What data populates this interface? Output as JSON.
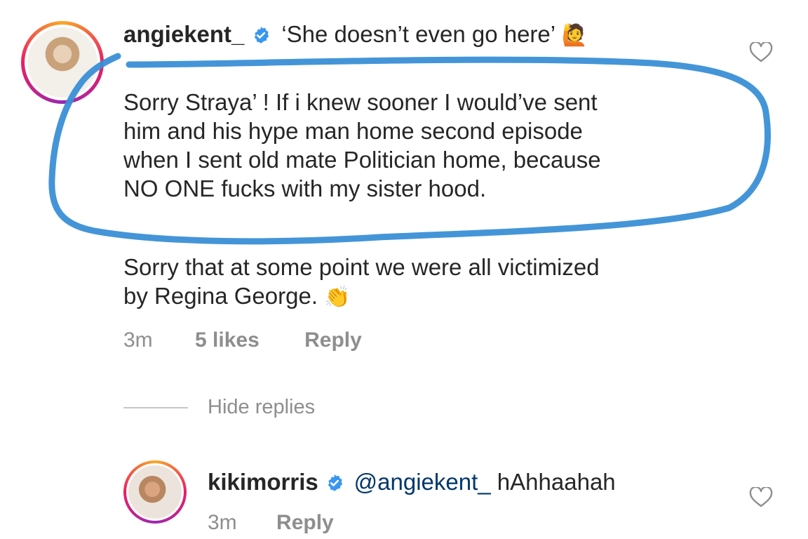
{
  "comment": {
    "username": "angiekent_",
    "headline": "‘She doesn’t even go here’",
    "emoji_headline": "🙋",
    "lines": [
      "Sorry Straya’ ! If i knew sooner I would’ve sent",
      "him and his hype man home second episode",
      "when I sent old mate Politician home, because",
      "NO ONE fucks with my sister hood."
    ],
    "lines2": [
      "Sorry that at some point we were  all victimized",
      "by Regina George."
    ],
    "emoji_end": "👏",
    "time": "3m",
    "likes": "5 likes",
    "reply": "Reply"
  },
  "hide_replies": "Hide replies",
  "reply_comment": {
    "username": "kikimorris",
    "mention": "@angiekent_",
    "text": " hAhhaahah",
    "time": "3m",
    "reply": "Reply"
  },
  "colors": {
    "highlight": "#3a8fd6",
    "verified": "#3897f0",
    "meta": "#8e8e8e"
  }
}
